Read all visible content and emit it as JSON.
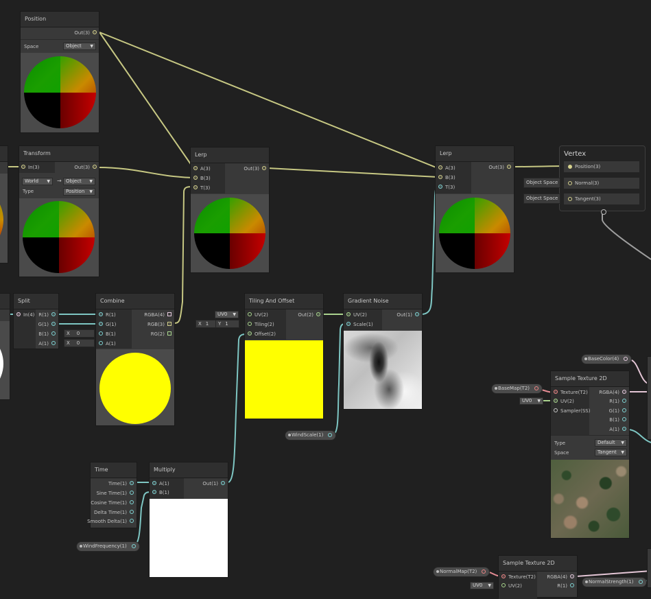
{
  "colors": {
    "background": "#202020",
    "wire_vector3": "#c7c883",
    "wire_vector1": "#7ec6c3",
    "wire_texture": "#e58c94"
  },
  "nodes": {
    "position": {
      "title": "Position",
      "out": "Out(3)",
      "space_label": "Space",
      "space_value": "Object"
    },
    "transform": {
      "title": "Transform",
      "in": "In(3)",
      "out": "Out(3)",
      "from": "World",
      "arrow": "→",
      "to": "Object",
      "type_label": "Type",
      "type_value": "Position"
    },
    "lerp1": {
      "title": "Lerp",
      "a": "A(3)",
      "b": "B(3)",
      "t": "T(3)",
      "out": "Out(3)"
    },
    "lerp2": {
      "title": "Lerp",
      "a": "A(3)",
      "b": "B(3)",
      "t": "T(3)",
      "out": "Out(3)"
    },
    "vertex": {
      "title": "Vertex",
      "position": "Position(3)",
      "normal": "Normal(3)",
      "tangent": "Tangent(3)",
      "normal_space": "Object Space",
      "tangent_space": "Object Space"
    },
    "split": {
      "title": "Split",
      "in": "In(4)",
      "r": "R(1)",
      "g": "G(1)",
      "b": "B(1)",
      "a": "A(1)"
    },
    "combine": {
      "title": "Combine",
      "r": "R(1)",
      "g": "G(1)",
      "b": "B(1)",
      "a": "A(1)",
      "rgba": "RGBA(4)",
      "rgb": "RGB(3)",
      "rg": "RG(2)",
      "b_x": "X",
      "b_val": "0",
      "a_x": "X",
      "a_val": "0"
    },
    "tiling": {
      "title": "Tiling And Offset",
      "uv": "UV(2)",
      "tiling": "Tiling(2)",
      "offset": "Offset(2)",
      "out": "Out(2)",
      "uv_channel": "UV0",
      "tx_label": "X",
      "tx": "1",
      "ty_label": "Y",
      "ty": "1"
    },
    "gradient": {
      "title": "Gradient Noise",
      "uv": "UV(2)",
      "scale": "Scale(1)",
      "out": "Out(1)"
    },
    "time": {
      "title": "Time",
      "time": "Time(1)",
      "sine": "Sine Time(1)",
      "cosine": "Cosine Time(1)",
      "delta": "Delta Time(1)",
      "smooth": "Smooth Delta(1)"
    },
    "multiply": {
      "title": "Multiply",
      "a": "A(1)",
      "b": "B(1)",
      "out": "Out(1)"
    },
    "sample1": {
      "title": "Sample Texture 2D",
      "texture": "Texture(T2)",
      "uv": "UV(2)",
      "sampler": "Sampler(SS)",
      "rgba": "RGBA(4)",
      "r": "R(1)",
      "g": "G(1)",
      "b": "B(1)",
      "a": "A(1)",
      "uv_channel": "UV0",
      "type_label": "Type",
      "type_value": "Default",
      "space_label": "Space",
      "space_value": "Tangent"
    },
    "sample2": {
      "title": "Sample Texture 2D",
      "texture": "Texture(T2)",
      "uv": "UV(2)",
      "rgba": "RGBA(4)",
      "r": "R(1)",
      "uv_channel": "UV0"
    }
  },
  "properties": {
    "wind_scale": "WindScale(1)",
    "wind_frequency": "WindFrequency(1)",
    "base_color": "BaseColor(4)",
    "base_map": "BaseMap(T2)",
    "normal_map": "NormalMap(T2)",
    "normal_strength": "NormalStrength(1)"
  }
}
